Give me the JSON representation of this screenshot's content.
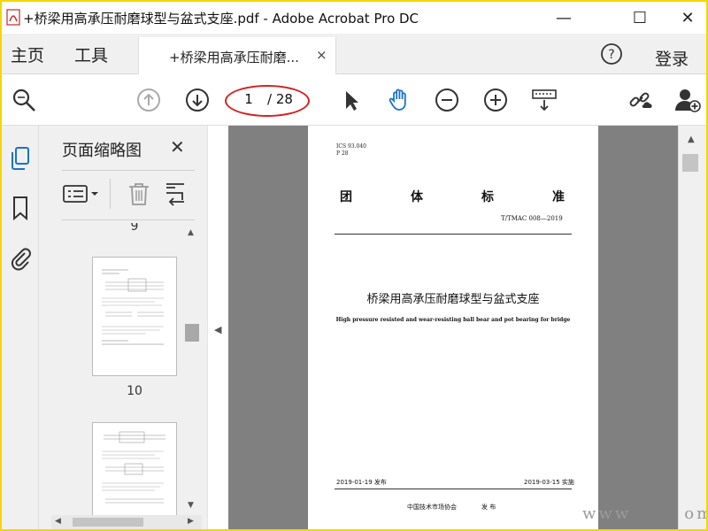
{
  "window": {
    "title": "+桥梁用高承压耐磨球型与盆式支座.pdf - Adobe Acrobat Pro DC",
    "controls": {
      "minimize": "—",
      "maximize": "☐",
      "close": "✕"
    }
  },
  "menu": {
    "home": "主页",
    "tools": "工具",
    "login": "登录"
  },
  "tab": {
    "label": "+桥梁用高承压耐磨...",
    "close": "×"
  },
  "toolbar": {
    "page_current": "1",
    "page_total": "/ 28",
    "icons": [
      "zoom-search-icon",
      "page-up-icon",
      "page-down-icon",
      "select-arrow-icon",
      "hand-tool-icon",
      "zoom-out-icon",
      "zoom-in-icon",
      "keyboard-marquee-icon",
      "share-link-icon",
      "add-user-icon"
    ]
  },
  "thumbnail_panel": {
    "title": "页面缩略图",
    "close": "✕",
    "items": [
      {
        "label": "9"
      },
      {
        "label": "10"
      }
    ]
  },
  "document": {
    "ics": "ICS 93.040",
    "ccs": "P 28",
    "heading_chars": [
      "团",
      "体",
      "标",
      "准"
    ],
    "code": "T/TMAC 008—2019",
    "title_cn": "桥梁用高承压耐磨球型与盆式支座",
    "title_en": "High pressure resisted and wear-resisting ball bear and pot bearing for bridge",
    "issue_date": "2019-01-19 发布",
    "impl_date": "2019-03-15 实施",
    "publisher": "中国技术市场协会",
    "publish_word": "发 布"
  },
  "watermark": "www",
  "watermark_tail": "om",
  "colors": {
    "accent_blue": "#1a73c8",
    "annotation_red": "#d32020",
    "frame_yellow": "#f4d600"
  }
}
